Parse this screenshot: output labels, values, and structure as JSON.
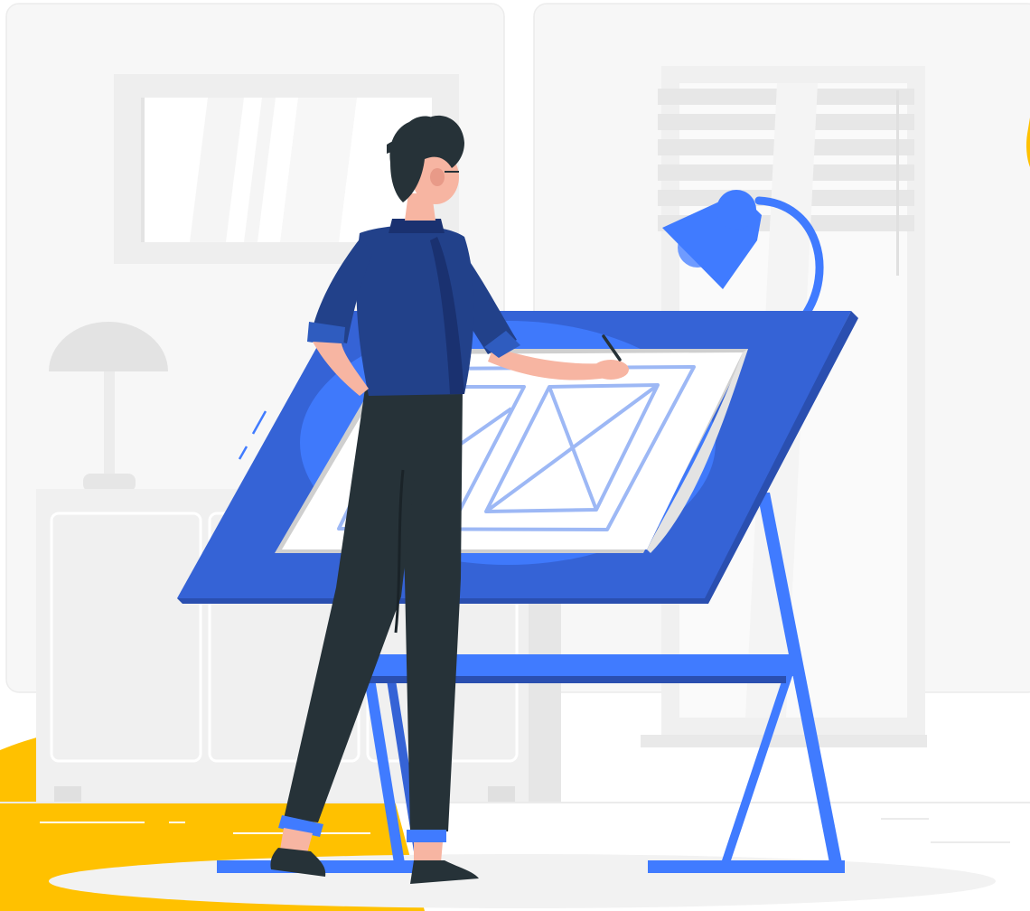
{
  "illustration": {
    "subject": "designer-at-drafting-table",
    "icons": [
      "drafting-table",
      "desk-lamp",
      "window-blinds",
      "framed-window",
      "table-lamp",
      "cabinet",
      "person-figure",
      "sketch-frame"
    ]
  },
  "colors": {
    "background": "#ffffff",
    "wall_panel": "#f7f7f7",
    "panel_border": "#ebebeb",
    "furniture": "#efefef",
    "furniture_shadow": "#e0e0e0",
    "accent_blue": "#407bff",
    "table_blue": "#3563d6",
    "table_blue_dark": "#2a4fb0",
    "shirt": "#22418a",
    "shirt_dark": "#1a3170",
    "pants": "#263238",
    "hair": "#263238",
    "skin": "#f7b5a2",
    "floor_yellow": "#ffc100",
    "floor_shadow": "#f2f2f2",
    "paper": "#ffffff",
    "paper_shadow": "#cfcfcf",
    "sketch_line": "#9db8f5"
  }
}
